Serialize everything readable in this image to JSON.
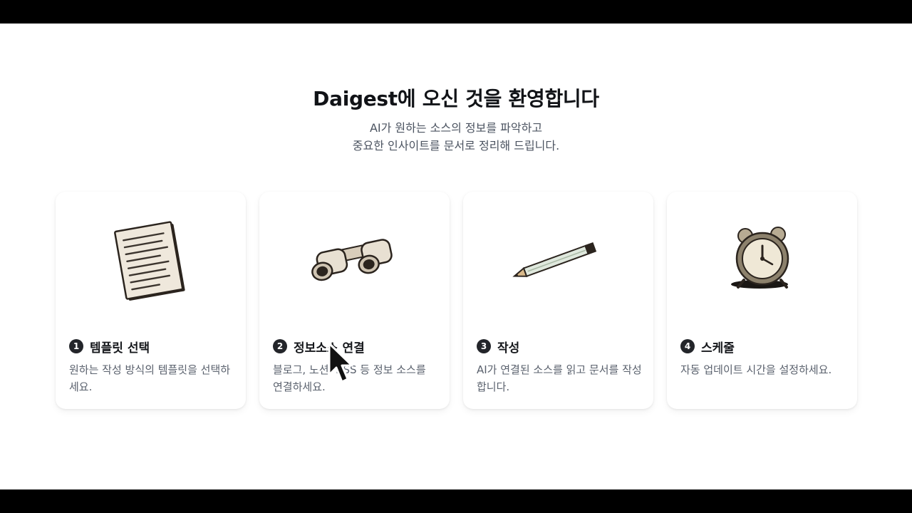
{
  "hero": {
    "title": "Daigest에 오신 것을 환영합니다",
    "subtitle_line1": "AI가 원하는 소스의 정보를 파악하고",
    "subtitle_line2": "중요한 인사이트를 문서로 정리해 드립니다."
  },
  "steps": [
    {
      "number": "1",
      "title": "템플릿 선택",
      "description": "원하는 작성 방식의 템플릿을 선택하세요.",
      "icon": "paper-icon"
    },
    {
      "number": "2",
      "title": "정보소스 연결",
      "description": "블로그, 노션, RSS 등 정보 소스를 연결하세요.",
      "icon": "binoculars-icon"
    },
    {
      "number": "3",
      "title": "작성",
      "description": "AI가 연결된 소스를 읽고 문서를 작성합니다.",
      "icon": "pencil-icon"
    },
    {
      "number": "4",
      "title": "스케줄",
      "description": "자동 업데이트 시간을 설정하세요.",
      "icon": "alarm-clock-icon"
    }
  ],
  "colors": {
    "background": "#ffffff",
    "heading": "#111317",
    "body_text": "#5a616d",
    "badge": "#23252a"
  }
}
